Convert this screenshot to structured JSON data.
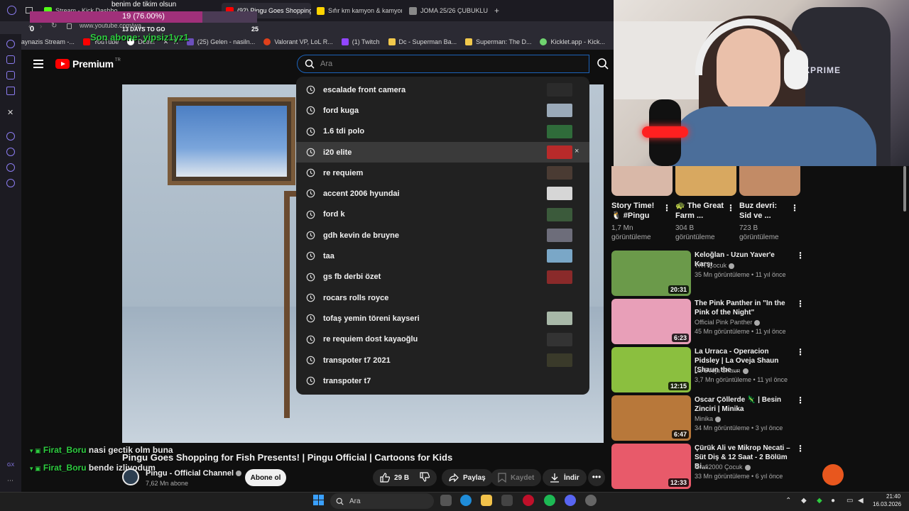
{
  "browser": {
    "tabs": [
      {
        "label": "Stream - Kick Dashboard",
        "color": "#53fc18"
      },
      {
        "label": "(92) Pingu Goes Shopping",
        "color": "#ff0000",
        "active": true
      },
      {
        "label": "Sıfır km kamyon & kamyonet",
        "color": "#ffd400"
      },
      {
        "label": "JOMA 25/26 ÇUBUKLU FO",
        "color": "#888888"
      }
    ],
    "url": "www.youtube.com/wa...",
    "bookmarks": [
      {
        "label": "taynazis Stream -...",
        "color": "#53fc18"
      },
      {
        "label": "YouTube",
        "color": "#ff0000"
      },
      {
        "label": "Dotrix",
        "color": "#ffffff"
      },
      {
        "label": "X",
        "color": "#dddddd"
      },
      {
        "label": "(25) Gelen - nasiln...",
        "color": "#6b4fbb"
      },
      {
        "label": "Valorant VP, LoL R...",
        "color": "#e0401b"
      },
      {
        "label": "(1) Twitch",
        "color": "#9146ff"
      },
      {
        "label": "Dc - Superman Ba...",
        "color": "#f2c94c"
      },
      {
        "label": "Superman: The D...",
        "color": "#f2c94c"
      },
      {
        "label": "Kicklet.app - Kick...",
        "color": "#6fd36f"
      }
    ]
  },
  "overlay": {
    "goal_title": "benim de tikim olsun",
    "progress_text": "19 (76.00%)",
    "progress_fraction": 0.76,
    "start": "0",
    "end": "25",
    "days_left": "13 DAYS TO GO",
    "last_sub": "Son abone: yipsiz1yz1"
  },
  "chat": [
    {
      "user": "Firat_Boru",
      "message": "nasi gectik olm buna"
    },
    {
      "user": "Firat_Boru",
      "message": "bende izliyodum"
    }
  ],
  "youtube": {
    "brand": "Premium",
    "region": "TR",
    "search_placeholder": "Ara",
    "suggestions": [
      {
        "text": "escalade front camera",
        "thumb": "#2b2b2b"
      },
      {
        "text": "ford kuga",
        "thumb": "#9aa9b8"
      },
      {
        "text": "1.6 tdi polo",
        "thumb": "#2f6b3a"
      },
      {
        "text": "i20 elite",
        "thumb": "#b82a2a",
        "highlighted": true,
        "remove": "×"
      },
      {
        "text": "re requiem",
        "thumb": "#4a3b33"
      },
      {
        "text": "accent 2006 hyundai",
        "thumb": "#d6d6d6"
      },
      {
        "text": "ford k",
        "thumb": "#3b5a3b"
      },
      {
        "text": "gdh kevin de bruyne",
        "thumb": "#6d6d7a"
      },
      {
        "text": "taa",
        "thumb": "#7aa7c7"
      },
      {
        "text": "gs fb derbi özet",
        "thumb": "#8a2a2a"
      },
      {
        "text": "rocars rolls royce",
        "thumb": ""
      },
      {
        "text": "tofaş yemin töreni kayseri",
        "thumb": "#a8b8a8"
      },
      {
        "text": "re requiem dost kayaoğlu",
        "thumb": "#333333"
      },
      {
        "text": "transpoter t7 2021",
        "thumb": "#3a3a2a"
      },
      {
        "text": "transpoter t7",
        "thumb": ""
      }
    ],
    "video": {
      "title": "Pingu Goes Shopping for Fish Presents! | Pingu Official | Cartoons for Kids",
      "channel": "Pingu - Official Channel",
      "subscribers": "7,62 Mn abone",
      "subscribe_label": "Abone ol",
      "likes": "29 B",
      "share_label": "Paylaş",
      "save_label": "Kaydet",
      "download_label": "İndir",
      "more_label": "•••"
    },
    "shorts": [
      {
        "title": "Story Time! 🐧 #Pingu",
        "views": "1,7 Mn görüntüleme",
        "color": "#d9b8a8"
      },
      {
        "title": "🐢 The Great Farm ...",
        "views": "304 B görüntüleme",
        "color": "#d8a860"
      },
      {
        "title": "Buz devri: Sid ve ...",
        "views": "723 B görüntüleme",
        "color": "#c28b66"
      }
    ],
    "recommended": [
      {
        "title": "Keloğlan - Uzun Yaver'e Karşı",
        "channel": "TRT Çocuk",
        "views": "35 Mn görüntüleme • 11 yıl önce",
        "duration": "20:31",
        "color": "#6b9a4a"
      },
      {
        "title": "The Pink Panther in \"In the Pink of the Night\"",
        "channel": "Official Pink Panther",
        "views": "45 Mn görüntüleme • 11 yıl önce",
        "duration": "6:23",
        "color": "#e89fb8"
      },
      {
        "title": "La Urraca - Operacion Pidsley | La Oveja Shaun [Shaun the ...",
        "channel": "La Oveja Shaun",
        "views": "3,7 Mn görüntüleme • 11 yıl önce",
        "duration": "12:15",
        "color": "#8bbf3f"
      },
      {
        "title": "Oscar Çöllerde 🦎 | Besin Zinciri | Minika",
        "channel": "Minika",
        "views": "34 Mn görüntüleme • 3 yıl önce",
        "duration": "6:47",
        "color": "#b8783a"
      },
      {
        "title": "Çürük Ali ve Mikrop Necati – Süt Diş & 12 Saat - 2 Bölüm Bi...",
        "channel": "Grafi2000 Çocuk",
        "views": "33 Mn görüntüleme • 6 yıl önce",
        "duration": "12:33",
        "color": "#e85a6a"
      }
    ]
  },
  "cam": {
    "brand": "XPRIME"
  },
  "taskbar": {
    "search_label": "Ara",
    "time": "21:40",
    "date": "16.03.2026"
  },
  "colors": {
    "accent": "#1c62b9",
    "youtube_red": "#ff0000",
    "chat_user": "#2ecc40"
  }
}
